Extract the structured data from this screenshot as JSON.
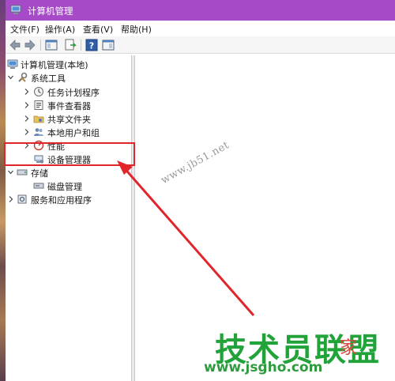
{
  "window": {
    "title": "计算机管理"
  },
  "menu": [
    "文件(F)",
    "操作(A)",
    "查看(V)",
    "帮助(H)"
  ],
  "toolbar": {
    "buttons": [
      "back-arrow-icon",
      "forward-arrow-icon",
      "show-tree-icon",
      "export-icon",
      "help-icon",
      "properties-icon"
    ]
  },
  "tree": {
    "root": "计算机管理(本地)",
    "system_tools": "系统工具",
    "task_scheduler": "任务计划程序",
    "event_viewer": "事件查看器",
    "shared_folders": "共享文件夹",
    "local_users_groups": "本地用户和组",
    "performance": "性能",
    "device_manager": "设备管理器",
    "storage": "存储",
    "disk_management": "磁盘管理",
    "services_apps": "服务和应用程序"
  },
  "annotation": {
    "watermark": "www.jb51.net",
    "brand": "技术员联盟",
    "brand_url": "www.jsgho.com",
    "brand_tail": "家",
    "color": "#e0262b"
  }
}
